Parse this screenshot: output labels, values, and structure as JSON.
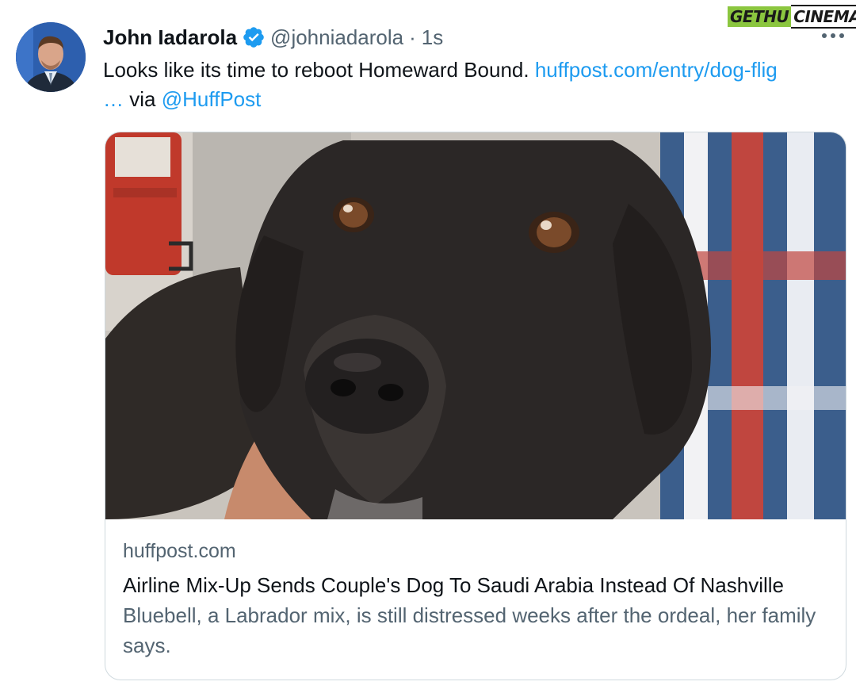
{
  "watermark": {
    "part1": "GETHU",
    "part2": "CINEMA"
  },
  "tweet": {
    "author": {
      "display_name": "John Iadarola",
      "handle": "@johniadarola",
      "verified_icon": "verified-badge-icon"
    },
    "separator": "·",
    "time": "1s",
    "text_main": "Looks like its time to reboot Homeward Bound.",
    "text_link": "huffpost.com/entry/dog-flig",
    "text_ellipsis": "…",
    "text_via": "via",
    "text_mention": "@HuffPost",
    "more_icon": "more-options-icon"
  },
  "card": {
    "domain": "huffpost.com",
    "title": "Airline Mix-Up Sends Couple's Dog To Saudi Arabia Instead Of Nashville",
    "description": "Bluebell, a Labrador mix, is still distressed weeks after the ordeal, her family says."
  },
  "colors": {
    "link": "#1d9bf0",
    "secondary_text": "#536471",
    "primary_text": "#0f1419",
    "border": "#cfd9de",
    "verified": "#1d9bf0"
  }
}
